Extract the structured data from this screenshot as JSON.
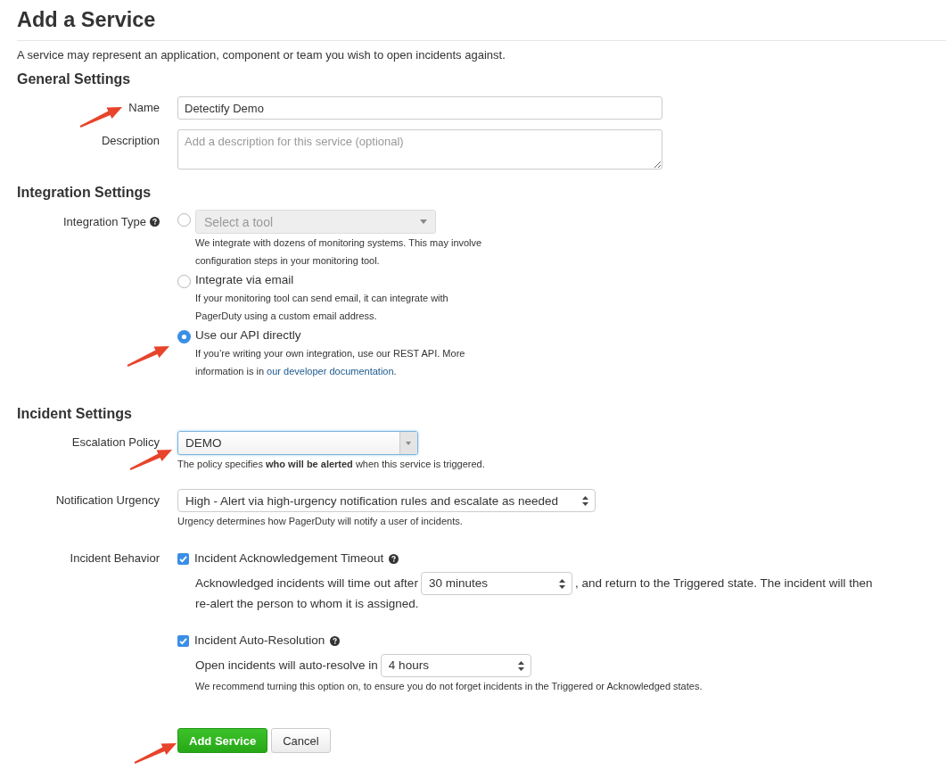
{
  "page": {
    "title": "Add a Service",
    "intro": "A service may represent an application, component or team you wish to open incidents against."
  },
  "general_settings": {
    "heading": "General Settings",
    "name": {
      "label": "Name",
      "value": "Detectify Demo",
      "pointer_arrow": true
    },
    "description": {
      "label": "Description",
      "placeholder": "Add a description for this service (optional)"
    }
  },
  "integration_settings": {
    "heading": "Integration Settings",
    "integration_type": {
      "label": "Integration Type",
      "help_icon": true,
      "options": [
        {
          "kind": "tool_select",
          "selected": false,
          "placeholder": "Select a tool",
          "disabled": true,
          "help": "We integrate with dozens of monitoring systems. This may involve configuration steps in your monitoring tool."
        },
        {
          "kind": "text",
          "selected": false,
          "label": "Integrate via email",
          "help": "If your monitoring tool can send email, it can integrate with PagerDuty using a custom email address."
        },
        {
          "kind": "text",
          "selected": true,
          "label": "Use our API directly",
          "help": "If you’re writing your own integration, use our REST API. More information is in ",
          "link": "our developer documentation",
          "help_end": ".",
          "pointer_arrow": true
        }
      ]
    }
  },
  "incident_settings": {
    "heading": "Incident Settings",
    "escalation_policy": {
      "label": "Escalation Policy",
      "value": "DEMO",
      "focused": true,
      "help": "The policy specifies **who will be alerted** when this service is triggered.",
      "pointer_arrow": true
    },
    "notification_urgency": {
      "label": "Notification Urgency",
      "value": "High - Alert via high-urgency notification rules and escalate as needed",
      "help": "Urgency determines how PagerDuty will notify a user of incidents."
    },
    "incident_behavior": {
      "label": "Incident Behavior",
      "options": [
        {
          "label": "Incident Acknowledgement Timeout",
          "checked": true,
          "help_icon": true,
          "text_before": "Acknowledged incidents will time out after",
          "select": "30 minutes",
          "text_after": ", and return to the Triggered state. The incident will then",
          "text_continued": "re-alert the person to whom it is assigned."
        },
        {
          "label": "Incident Auto-Resolution",
          "checked": true,
          "help_icon": true,
          "text_before": "Open incidents will auto-resolve in",
          "select": "4 hours",
          "note": "We recommend turning this option on, to ensure you do not forget incidents in the Triggered or Acknowledged states."
        }
      ]
    }
  },
  "buttons": [
    {
      "kind": "primary",
      "label": "Add Service",
      "pointer_arrow": true
    },
    {
      "kind": "default",
      "label": "Cancel"
    }
  ]
}
